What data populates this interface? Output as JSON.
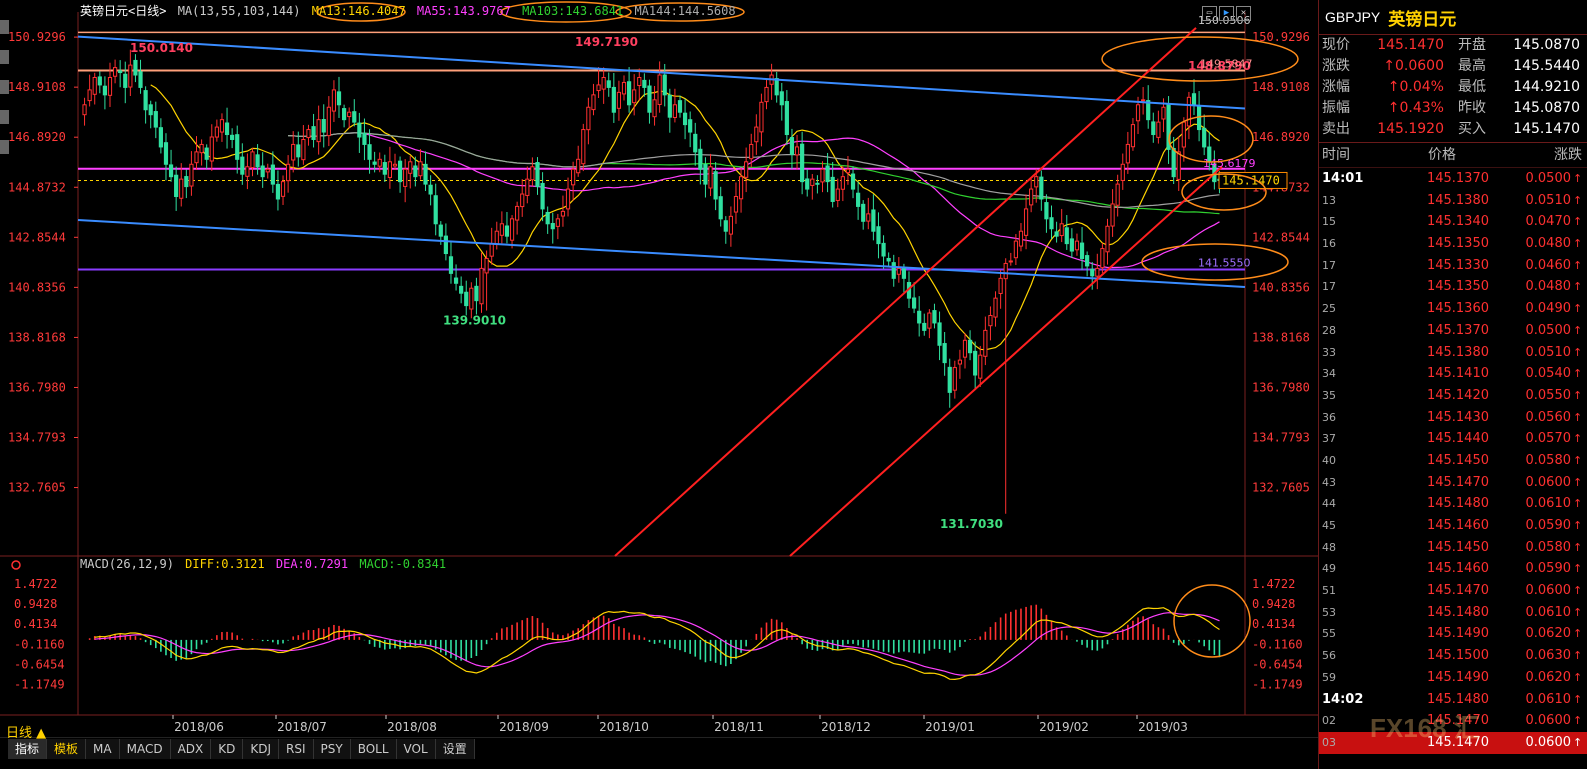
{
  "header": {
    "title": "英镑日元<日线>",
    "ma_label": "MA(13,55,103,144)",
    "ma13": "MA13:146.4047",
    "ma55": "MA55:143.9767",
    "ma103": "MA103:143.6841",
    "ma144": "MA144:144.5608"
  },
  "macd_header": {
    "label": "MACD(26,12,9)",
    "diff": "DIFF:0.3121",
    "dea": "DEA:0.7291",
    "macd": "MACD:-0.8341"
  },
  "period_label": "日线 ▲",
  "tabs": [
    "指标",
    "模板",
    "MA",
    "MACD",
    "ADX",
    "KD",
    "KDJ",
    "RSI",
    "PSY",
    "BOLL",
    "VOL",
    "设置"
  ],
  "info": {
    "symbol": "GBPJPY",
    "name": "英镑日元",
    "quotes": [
      {
        "l1": "现价",
        "v1": "145.1470",
        "l2": "开盘",
        "v2": "145.0870"
      },
      {
        "l1": "涨跌",
        "v1": "↑0.0600",
        "l2": "最高",
        "v2": "145.5440"
      },
      {
        "l1": "涨幅",
        "v1": "↑0.04%",
        "l2": "最低",
        "v2": "144.9210"
      },
      {
        "l1": "振幅",
        "v1": "↑0.43%",
        "l2": "昨收",
        "v2": "145.0870"
      },
      {
        "l1": "卖出",
        "v1": "145.1920",
        "l2": "买入",
        "v2": "145.1470"
      }
    ],
    "tick_headers": [
      "时间",
      "价格",
      "涨跌"
    ],
    "ticks": [
      {
        "t": "14:01",
        "p": "145.1370",
        "d": "0.0500"
      },
      {
        "t": "13",
        "p": "145.1380",
        "d": "0.0510"
      },
      {
        "t": "15",
        "p": "145.1340",
        "d": "0.0470"
      },
      {
        "t": "16",
        "p": "145.1350",
        "d": "0.0480"
      },
      {
        "t": "17",
        "p": "145.1330",
        "d": "0.0460"
      },
      {
        "t": "17",
        "p": "145.1350",
        "d": "0.0480"
      },
      {
        "t": "25",
        "p": "145.1360",
        "d": "0.0490"
      },
      {
        "t": "28",
        "p": "145.1370",
        "d": "0.0500"
      },
      {
        "t": "33",
        "p": "145.1380",
        "d": "0.0510"
      },
      {
        "t": "34",
        "p": "145.1410",
        "d": "0.0540"
      },
      {
        "t": "35",
        "p": "145.1420",
        "d": "0.0550"
      },
      {
        "t": "36",
        "p": "145.1430",
        "d": "0.0560"
      },
      {
        "t": "37",
        "p": "145.1440",
        "d": "0.0570"
      },
      {
        "t": "40",
        "p": "145.1450",
        "d": "0.0580"
      },
      {
        "t": "43",
        "p": "145.1470",
        "d": "0.0600"
      },
      {
        "t": "44",
        "p": "145.1480",
        "d": "0.0610"
      },
      {
        "t": "45",
        "p": "145.1460",
        "d": "0.0590"
      },
      {
        "t": "48",
        "p": "145.1450",
        "d": "0.0580"
      },
      {
        "t": "49",
        "p": "145.1460",
        "d": "0.0590"
      },
      {
        "t": "51",
        "p": "145.1470",
        "d": "0.0600"
      },
      {
        "t": "53",
        "p": "145.1480",
        "d": "0.0610"
      },
      {
        "t": "55",
        "p": "145.1490",
        "d": "0.0620"
      },
      {
        "t": "56",
        "p": "145.1500",
        "d": "0.0630"
      },
      {
        "t": "59",
        "p": "145.1490",
        "d": "0.0620"
      },
      {
        "t": "14:02",
        "p": "145.1480",
        "d": "0.0610"
      },
      {
        "t": "02",
        "p": "145.1470",
        "d": "0.0600"
      },
      {
        "t": "03",
        "p": "145.1470",
        "d": "0.0600"
      }
    ]
  },
  "watermark": "FX168 汇",
  "chart_data": [
    {
      "type": "candlestick",
      "title": "英镑日元<日线>",
      "x_categories": [
        "2018/06",
        "2018/07",
        "2018/08",
        "2018/09",
        "2018/10",
        "2018/11",
        "2018/12",
        "2019/01",
        "2019/02",
        "2019/03"
      ],
      "y_ticks": [
        "150.9296",
        "148.9108",
        "146.8920",
        "144.8732",
        "142.8544",
        "140.8356",
        "138.8168",
        "136.7980",
        "134.7793",
        "132.7605"
      ],
      "ylim": [
        130.0,
        151.7
      ],
      "annotations": {
        "high_labels": [
          "150.0140",
          "149.7190",
          "148.8790"
        ],
        "low_labels": [
          "139.9010",
          "131.7030"
        ],
        "level_labels": [
          "149.5847",
          "145.6179",
          "141.5550"
        ],
        "current_price": "145.1470",
        "top_right_label": "150.0506"
      },
      "horizontal_lines": [
        {
          "name": "resistance",
          "value": 149.5847,
          "color": "#ffa07a"
        },
        {
          "name": "pivot",
          "value": 145.6179,
          "color": "#ff40ff"
        },
        {
          "name": "support",
          "value": 141.555,
          "color": "#8a3cff"
        }
      ],
      "trend_lines": [
        {
          "name": "upper-blue",
          "from": [
            "2018/05",
            150.95
          ],
          "to": [
            "2019/03-end",
            148.0
          ],
          "color": "#3a8cff"
        },
        {
          "name": "lower-blue",
          "from": [
            "2018/05",
            143.5
          ],
          "to": [
            "2019/03-end",
            141.0
          ],
          "color": "#3a8cff"
        },
        {
          "name": "channel-upper-red",
          "from": [
            "2018/12",
            130.0
          ],
          "to": [
            "2019/03-end",
            151.3
          ],
          "color": "#ff2020"
        },
        {
          "name": "channel-lower-red",
          "from": [
            "2018/12",
            130.0
          ],
          "to": [
            "2019/03-end",
            145.7
          ],
          "color": "#ff2020"
        }
      ],
      "closes": [
        148.2,
        148.8,
        149.3,
        149.0,
        148.6,
        149.3,
        149.7,
        149.5,
        148.9,
        149.8,
        149.4,
        148.9,
        148.0,
        147.8,
        147.3,
        146.5,
        145.8,
        145.3,
        144.5,
        145.2,
        144.9,
        145.8,
        146.3,
        146.6,
        146.0,
        146.9,
        147.3,
        147.6,
        147.0,
        146.8,
        146.0,
        145.4,
        145.7,
        146.3,
        145.7,
        145.3,
        145.6,
        145.0,
        144.4,
        145.1,
        145.8,
        146.6,
        146.1,
        146.8,
        147.2,
        146.8,
        147.6,
        147.1,
        148.1,
        148.8,
        148.2,
        147.6,
        147.9,
        147.5,
        146.9,
        146.6,
        146.0,
        145.8,
        146.0,
        145.4,
        145.9,
        145.8,
        145.1,
        145.6,
        145.9,
        145.3,
        145.9,
        145.0,
        144.6,
        143.4,
        142.9,
        142.2,
        141.4,
        141.0,
        140.6,
        140.1,
        140.8,
        140.3,
        141.6,
        142.0,
        142.6,
        143.1,
        143.4,
        142.9,
        143.6,
        144.1,
        144.6,
        145.2,
        145.7,
        144.9,
        144.0,
        143.4,
        143.2,
        143.6,
        143.9,
        144.8,
        145.6,
        146.0,
        147.2,
        148.1,
        148.6,
        149.0,
        149.3,
        148.9,
        147.9,
        148.7,
        149.1,
        148.2,
        148.8,
        149.3,
        148.9,
        147.9,
        148.4,
        149.4,
        148.6,
        147.7,
        148.2,
        147.9,
        147.4,
        147.1,
        146.3,
        145.6,
        145.0,
        145.7,
        144.4,
        143.6,
        143.1,
        143.7,
        144.5,
        145.3,
        145.9,
        146.6,
        147.3,
        148.3,
        148.9,
        149.4,
        148.6,
        148.2,
        147.0,
        146.2,
        146.5,
        145.1,
        144.8,
        145.2,
        145.0,
        145.6,
        145.1,
        144.3,
        144.8,
        145.3,
        145.6,
        144.8,
        144.1,
        143.5,
        143.8,
        143.1,
        142.6,
        142.1,
        141.9,
        141.2,
        141.6,
        141.2,
        140.4,
        140.0,
        139.4,
        139.1,
        139.8,
        139.4,
        138.5,
        137.8,
        136.6,
        137.6,
        137.9,
        138.7,
        138.2,
        137.3,
        138.1,
        139.1,
        139.7,
        140.4,
        141.2,
        141.8,
        141.9,
        142.7,
        143.1,
        144.0,
        144.8,
        145.3,
        144.4,
        143.6,
        143.2,
        142.9,
        143.4,
        142.6,
        142.3,
        142.7,
        142.0,
        141.7,
        141.3,
        141.6,
        142.4,
        143.3,
        144.2,
        145.0,
        145.8,
        146.6,
        147.4,
        148.2,
        148.4,
        147.6,
        147.0,
        147.5,
        148.1,
        146.4,
        145.3,
        146.3,
        147.5,
        148.5,
        148.2,
        147.2,
        146.5,
        145.9,
        145.1,
        145.147
      ],
      "ma_series": [
        {
          "name": "MA13",
          "color": "#ffd400"
        },
        {
          "name": "MA55",
          "color": "#ff40ff"
        },
        {
          "name": "MA103",
          "color": "#30d030"
        },
        {
          "name": "MA144",
          "color": "#a0a0a0"
        }
      ]
    },
    {
      "type": "macd",
      "title": "MACD(26,12,9)",
      "y_ticks": [
        "1.4722",
        "0.9428",
        "0.4134",
        "-0.1160",
        "-0.6454",
        "-1.1749"
      ],
      "ylim": [
        -1.8,
        1.9
      ],
      "series": [
        {
          "name": "DIFF",
          "color": "#ffd400"
        },
        {
          "name": "DEA",
          "color": "#ff40ff"
        },
        {
          "name": "MACD",
          "color": "#30d030"
        }
      ]
    }
  ]
}
